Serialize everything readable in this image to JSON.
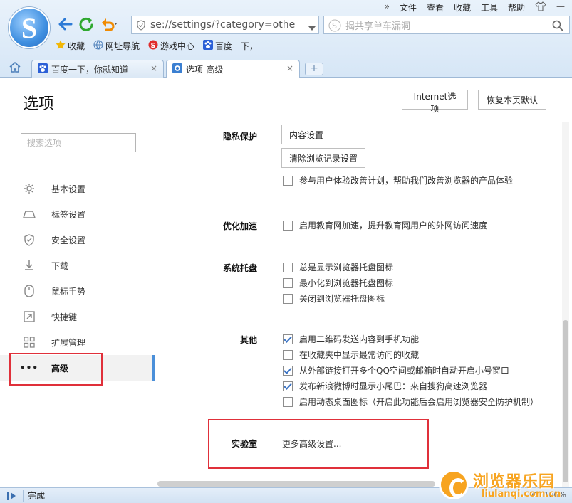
{
  "menu": [
    "文件",
    "查看",
    "收藏",
    "工具",
    "帮助"
  ],
  "address": {
    "value": "se://settings/?category=othe"
  },
  "search": {
    "placeholder": "揭共享单车漏洞"
  },
  "favorites": [
    {
      "label": "收藏",
      "icon": "star-icon"
    },
    {
      "label": "网址导航",
      "icon": "globe-icon"
    },
    {
      "label": "游戏中心",
      "icon": "game-icon"
    },
    {
      "label": "百度一下，",
      "icon": "baidu-paw-icon"
    }
  ],
  "tabs": [
    {
      "label": "百度一下，你就知道",
      "icon": "baidu-paw-icon",
      "close": "×"
    },
    {
      "label": "选项-高级",
      "icon": "gear-icon",
      "close": "×"
    }
  ],
  "newtab": "+",
  "page": {
    "title": "选项",
    "btn_internet": "Internet选项",
    "btn_reset": "恢复本页默认",
    "sidebar_search_placeholder": "搜索选项"
  },
  "sidebar": [
    {
      "label": "基本设置",
      "icon": "gear-icon"
    },
    {
      "label": "标签设置",
      "icon": "tab-icon"
    },
    {
      "label": "安全设置",
      "icon": "shield-icon"
    },
    {
      "label": "下载",
      "icon": "download-icon"
    },
    {
      "label": "鼠标手势",
      "icon": "mouse-icon"
    },
    {
      "label": "快捷键",
      "icon": "shortcut-icon"
    },
    {
      "label": "扩展管理",
      "icon": "extension-icon"
    },
    {
      "label": "高级",
      "icon": "more-dots-icon",
      "active": true
    }
  ],
  "sections": {
    "privacy": {
      "label": "隐私保护",
      "btn_content": "内容设置",
      "btn_clear": "清除浏览记录设置",
      "opt_experience": "参与用户体验改善计划，帮助我们改善浏览器的产品体验"
    },
    "speed": {
      "label": "优化加速",
      "opt_edu": "启用教育网加速，提升教育网用户的外网访问速度"
    },
    "tray": {
      "label": "系统托盘",
      "opts": [
        "总是显示浏览器托盘图标",
        "最小化到浏览器托盘图标",
        "关闭到浏览器托盘图标"
      ]
    },
    "other": {
      "label": "其他",
      "opts": [
        {
          "text": "启用二维码发送内容到手机功能",
          "checked": true
        },
        {
          "text": "在收藏夹中显示最常访问的收藏",
          "checked": false
        },
        {
          "text": "从外部链接打开多个QQ空间或邮箱时自动开启小号窗口",
          "checked": true
        },
        {
          "text": "发布新浪微博时显示小尾巴：来自搜狗高速浏览器",
          "checked": true
        },
        {
          "text": "启用动态桌面图标（开启此功能后会启用浏览器安全防护机制）",
          "checked": false
        }
      ]
    },
    "lab": {
      "label": "实验室",
      "link": "更多高级设置..."
    }
  },
  "status": {
    "text": "完成",
    "zoom": "100%",
    "count": "0"
  },
  "watermark": {
    "text": "浏览器乐园",
    "url": "liulanqi.com.cn"
  },
  "colors": {
    "accent": "#4a8fd9",
    "highlight": "#e0303a",
    "chrome": "#dbe8f5"
  }
}
